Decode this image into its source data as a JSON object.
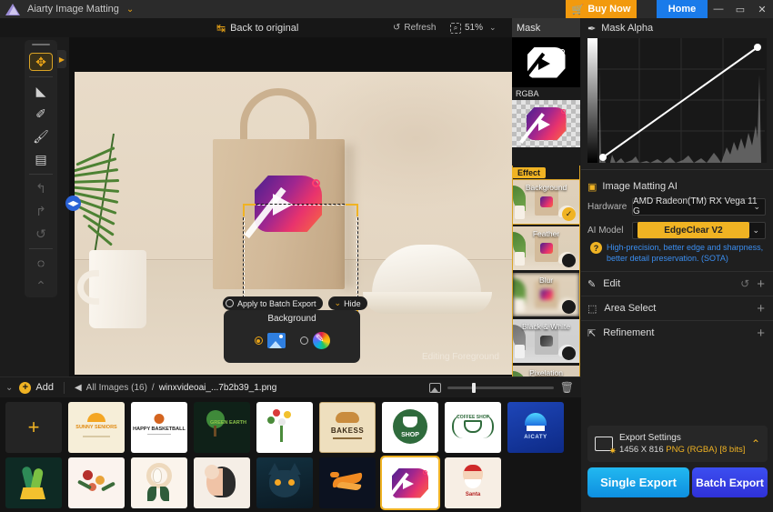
{
  "titlebar": {
    "app_name": "Aiarty Image Matting",
    "caret": "⌄",
    "buy_now": "Buy Now",
    "cart_icon": "cart-icon",
    "home": "Home",
    "minimize": "—",
    "maximize": "▭",
    "close": "✕"
  },
  "editor_toolbar": {
    "back_to_original": "Back to original",
    "back_icon": "↹",
    "refresh": "Refresh",
    "refresh_icon": "↺",
    "zoom_value": "51%",
    "zoom_icon": "search-icon",
    "zoom_caret": "⌄"
  },
  "tools": {
    "items": [
      {
        "name": "move-tool",
        "glyph": "✥",
        "selected": true,
        "disabled": false
      },
      {
        "name": "eraser-tool",
        "glyph": "◣",
        "selected": false,
        "disabled": false
      },
      {
        "name": "restore-brush-tool",
        "glyph": "✎",
        "selected": false,
        "disabled": false
      },
      {
        "name": "brush-tool",
        "glyph": "🖌",
        "selected": false,
        "disabled": false
      },
      {
        "name": "paint-roller-tool",
        "glyph": "▭",
        "selected": false,
        "disabled": false
      },
      {
        "name": "undo-tool",
        "glyph": "↰",
        "selected": false,
        "disabled": true
      },
      {
        "name": "redo-tool",
        "glyph": "↱",
        "selected": false,
        "disabled": true
      },
      {
        "name": "reset-tool",
        "glyph": "↺",
        "selected": false,
        "disabled": true
      },
      {
        "name": "marquee-tool",
        "glyph": "◌",
        "selected": false,
        "disabled": false
      }
    ],
    "collapse": "⌃",
    "expand_arrow": "▶"
  },
  "canvas": {
    "watermark": "Editing Foreground",
    "split_handle": "◀▶",
    "apply_to_batch": "Apply to Batch Export",
    "hide": "Hide",
    "hide_caret": "⌄",
    "background_popup": {
      "title": "Background",
      "option_image": "background-image-swatch",
      "option_color": "background-color-picker",
      "selected": "image"
    }
  },
  "effects_column": {
    "mask_tab": "Mask",
    "rgba_label": "RGBA",
    "effect_tag": "Effect",
    "items": [
      {
        "label": "Background",
        "selected": true
      },
      {
        "label": "Feather",
        "selected": false
      },
      {
        "label": "Blur",
        "selected": false
      },
      {
        "label": "Black & White",
        "selected": false
      },
      {
        "label": "Pixelation",
        "selected": false
      }
    ]
  },
  "right_panel": {
    "mask_alpha": {
      "title": "Mask Alpha",
      "icon": "eyedropper-icon"
    },
    "matting": {
      "title": "Image Matting AI",
      "icon": "image-ai-icon",
      "hardware_label": "Hardware",
      "hardware_value": "AMD Radeon(TM) RX Vega 11 G",
      "model_label": "AI Model",
      "model_value": "EdgeClear  V2",
      "model_desc": "High-precision, better edge and sharpness, better detail preservation. (SOTA)",
      "help_icon": "?",
      "caret": "⌄"
    },
    "accordions": [
      {
        "label": "Edit",
        "icon": "edit-icon",
        "has_undo": true,
        "plus": "+"
      },
      {
        "label": "Area Select",
        "icon": "area-select-icon",
        "has_undo": false,
        "plus": "+"
      },
      {
        "label": "Refinement",
        "icon": "refinement-icon",
        "has_undo": false,
        "plus": "+"
      }
    ],
    "export": {
      "title": "Export Settings",
      "dimensions": "1456 X 816",
      "format": "PNG (RGBA) [8 bits]",
      "collapse_caret": "⌃",
      "single_export": "Single Export",
      "batch_export": "Batch Export"
    }
  },
  "film_strip": {
    "collapse_icon": "⌄",
    "add_label": "Add",
    "add_plus": "+",
    "breadcrumb_back": "◀",
    "breadcrumb_root": "All Images (16)",
    "breadcrumb_sep": "/",
    "breadcrumb_current": "winxvideoai_...7b2b39_1.png",
    "thumb_size_icon": "thumbnail-size-icon",
    "delete_icon": "🗑",
    "thumbnails": [
      {
        "name": "add-image-cell",
        "kind": "add",
        "label": ""
      },
      {
        "name": "thumb-sunny-seniors",
        "kind": "logo",
        "label": "SUNNY SENIORS"
      },
      {
        "name": "thumb-happy-basketball",
        "kind": "logo",
        "label": "HAPPY BASKETBALL"
      },
      {
        "name": "thumb-green-earth",
        "kind": "logo",
        "label": "GREEN EARTH"
      },
      {
        "name": "thumb-flowers-1",
        "kind": "art",
        "label": ""
      },
      {
        "name": "thumb-bakess",
        "kind": "logo",
        "label": "BAKESS"
      },
      {
        "name": "thumb-coffee-shop-1",
        "kind": "logo",
        "label": "SHOP"
      },
      {
        "name": "thumb-coffee-shop-2",
        "kind": "logo",
        "label": "COFFEE SHOP"
      },
      {
        "name": "thumb-aicaty",
        "kind": "logo",
        "label": "AICATY"
      },
      {
        "name": "thumb-plant-logo",
        "kind": "logo",
        "label": ""
      },
      {
        "name": "thumb-flowers-2",
        "kind": "art",
        "label": ""
      },
      {
        "name": "thumb-lily",
        "kind": "art",
        "label": ""
      },
      {
        "name": "thumb-portrait",
        "kind": "art",
        "label": ""
      },
      {
        "name": "thumb-cat",
        "kind": "art",
        "label": ""
      },
      {
        "name": "thumb-bird",
        "kind": "art",
        "label": ""
      },
      {
        "name": "thumb-tag-logo",
        "kind": "logo",
        "label": "",
        "selected": true
      },
      {
        "name": "thumb-santa",
        "kind": "art",
        "label": "Santa"
      }
    ]
  },
  "colors": {
    "accent_yellow": "#f0b323",
    "buy_orange": "#f29a0e",
    "home_blue": "#1a7bea",
    "link_blue": "#3b8ef0",
    "single_export": "#12a7ea",
    "batch_export": "#3340e0"
  }
}
